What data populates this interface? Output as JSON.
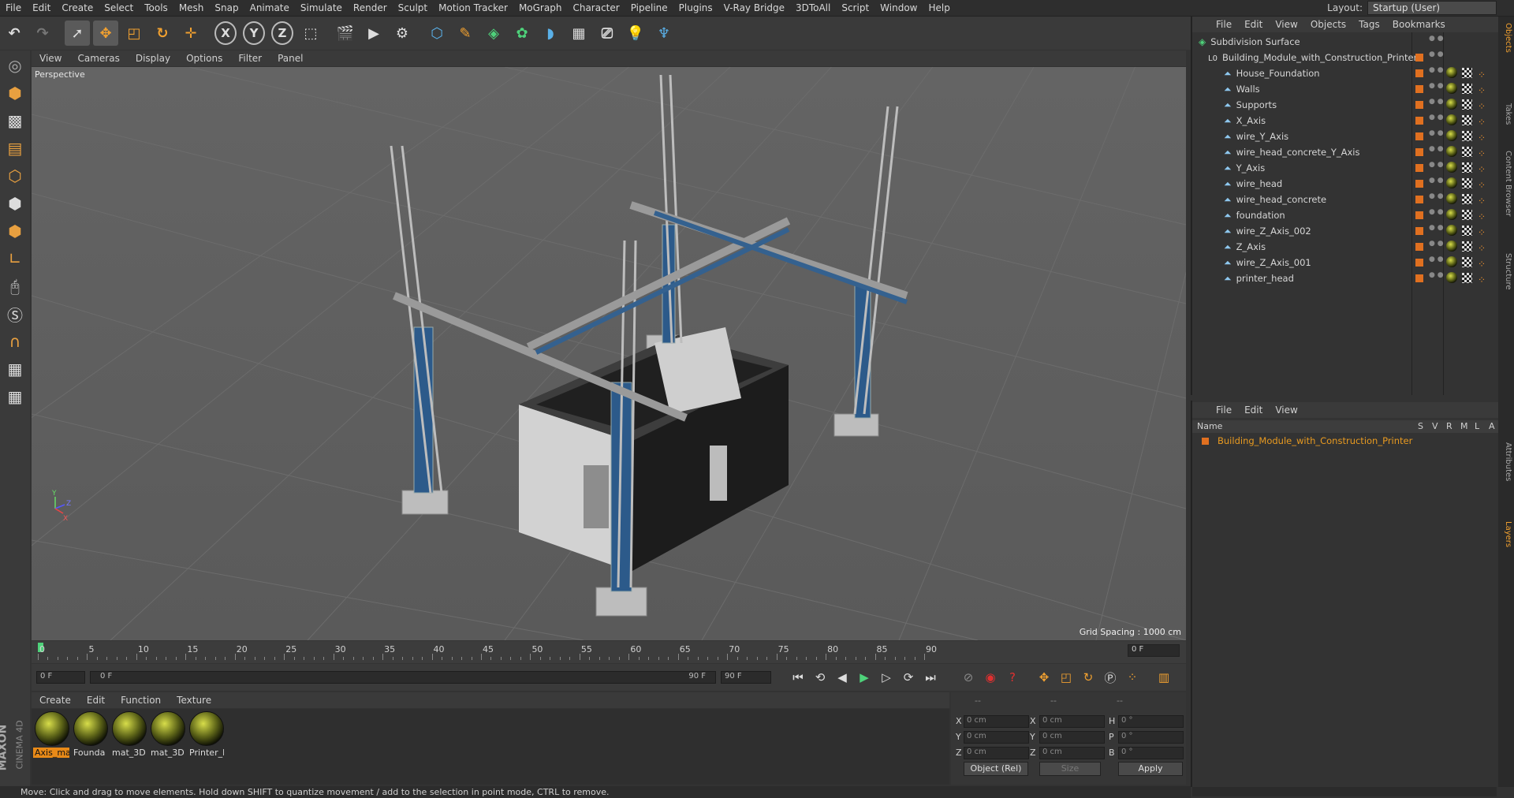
{
  "menubar": {
    "items": [
      "File",
      "Edit",
      "Create",
      "Select",
      "Tools",
      "Mesh",
      "Snap",
      "Animate",
      "Simulate",
      "Render",
      "Sculpt",
      "Motion Tracker",
      "MoGraph",
      "Character",
      "Pipeline",
      "Plugins",
      "V-Ray Bridge",
      "3DToAll",
      "Script",
      "Window",
      "Help"
    ],
    "layout_label": "Layout:",
    "layout_value": "Startup (User)"
  },
  "toolbar": {
    "axis_x": "X",
    "axis_y": "Y",
    "axis_z": "Z"
  },
  "viewport": {
    "menu": [
      "View",
      "Cameras",
      "Display",
      "Options",
      "Filter",
      "Panel"
    ],
    "label": "Perspective",
    "grid_spacing": "Grid Spacing : 1000 cm",
    "axis_y": "Y",
    "axis_z": "Z",
    "axis_x": "X"
  },
  "timeline": {
    "ticks": [
      "0",
      "5",
      "10",
      "15",
      "20",
      "25",
      "30",
      "35",
      "40",
      "45",
      "50",
      "55",
      "60",
      "65",
      "70",
      "75",
      "80",
      "85",
      "90"
    ],
    "current_frame": "0 F"
  },
  "playback": {
    "start_field": "0 F",
    "range_start": "0 F",
    "range_end": "90 F",
    "end_field": "90 F"
  },
  "material_manager": {
    "menu": [
      "Create",
      "Edit",
      "Function",
      "Texture"
    ],
    "materials": [
      {
        "label": "Axis_ma",
        "selected": true
      },
      {
        "label": "Founda",
        "selected": false
      },
      {
        "label": "mat_3D",
        "selected": false
      },
      {
        "label": "mat_3D",
        "selected": false
      },
      {
        "label": "Printer_l",
        "selected": false
      }
    ]
  },
  "coordinates": {
    "header_a": "--",
    "header_b": "--",
    "header_c": "--",
    "rows": [
      {
        "a_label": "X",
        "a_val": "0 cm",
        "b_label": "X",
        "b_val": "0 cm",
        "c_label": "H",
        "c_val": "0 °"
      },
      {
        "a_label": "Y",
        "a_val": "0 cm",
        "b_label": "Y",
        "b_val": "0 cm",
        "c_label": "P",
        "c_val": "0 °"
      },
      {
        "a_label": "Z",
        "a_val": "0 cm",
        "b_label": "Z",
        "b_val": "0 cm",
        "c_label": "B",
        "c_val": "0 °"
      }
    ],
    "mode": "Object (Rel)",
    "size": "Size",
    "apply": "Apply"
  },
  "brand": {
    "line1": "MAXON",
    "line2": "CINEMA 4D"
  },
  "status": "Move: Click and drag to move elements. Hold down SHIFT to quantize movement / add to the selection in point mode, CTRL to remove.",
  "object_manager": {
    "menu": [
      "File",
      "Edit",
      "View",
      "Objects",
      "Tags",
      "Bookmarks"
    ],
    "root": "Subdivision Surface",
    "group": "Building_Module_with_Construction_Printer",
    "children": [
      "House_Foundation",
      "Walls",
      "Supports",
      "X_Axis",
      "wire_Y_Axis",
      "wire_head_concrete_Y_Axis",
      "Y_Axis",
      "wire_head",
      "wire_head_concrete",
      "foundation",
      "wire_Z_Axis_002",
      "Z_Axis",
      "wire_Z_Axis_001",
      "printer_head"
    ]
  },
  "layer_manager": {
    "menu": [
      "File",
      "Edit",
      "View"
    ],
    "header_name": "Name",
    "cols": [
      "S",
      "V",
      "R",
      "M",
      "L",
      "A"
    ],
    "layer": "Building_Module_with_Construction_Printer"
  },
  "right_tabs": [
    "Objects",
    "Takes",
    "Content Browser",
    "Structure",
    "Attributes",
    "Layers"
  ],
  "colors": {
    "accent": "#e88a18",
    "viewport": "#5f5f5f",
    "panel": "#333333"
  }
}
